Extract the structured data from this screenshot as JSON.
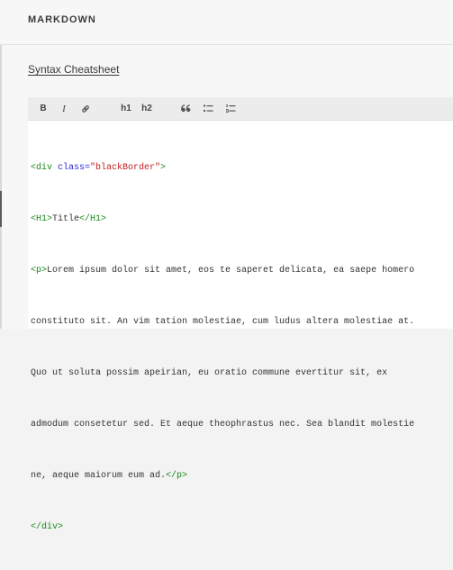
{
  "header": {
    "title": "MARKDOWN"
  },
  "cheatsheet": {
    "label": "Syntax Cheatsheet"
  },
  "toolbar": {
    "bold": "B",
    "italic": "I",
    "h1": "h1",
    "h2": "h2",
    "icons": [
      "bold",
      "italic",
      "link-icon",
      "h1",
      "h2",
      "quote-icon",
      "unordered-list-icon",
      "ordered-list-icon"
    ]
  },
  "editor": {
    "line1": {
      "open": "<div ",
      "attr": "class=",
      "value": "\"blackBorder\"",
      "close": ">"
    },
    "line2": {
      "open": "<H1>",
      "text": "Title",
      "close": "</H1>"
    },
    "para": {
      "open": "<p>",
      "l1": "Lorem ipsum dolor sit amet, eos te saperet delicata, ea saepe homero",
      "l2": "constituto sit. An vim tation molestiae, cum ludus altera molestiae at.",
      "l3": "Quo ut soluta possim apeirian, eu oratio commune evertitur sit, ex",
      "l4": "admodum consetetur sed. Et aeque theophrastus nec. Sea blandit molestie",
      "l5": "ne, aeque maiorum eum ad.",
      "close": "</p>"
    },
    "line_end": "</div>"
  },
  "colors": {
    "tag": "#1a8a1a",
    "attr": "#2a2ad6",
    "string": "#c41a1a"
  }
}
